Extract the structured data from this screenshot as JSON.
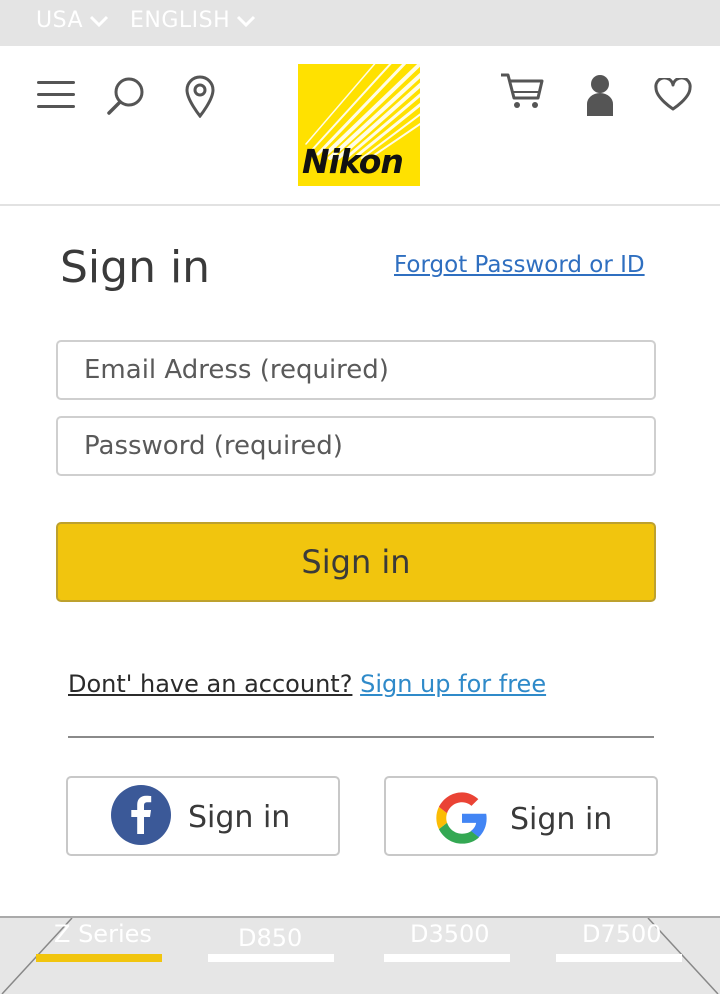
{
  "topbar": {
    "country": "USA",
    "language": "ENGLISH"
  },
  "header": {
    "logo_text": "Nikon",
    "icons": [
      "menu-icon",
      "search-icon",
      "location-pin-icon",
      "cart-icon",
      "user-icon",
      "heart-icon"
    ]
  },
  "signin": {
    "title": "Sign in",
    "forgot_link": "Forgot Password or ID",
    "email_placeholder": "Email Adress (required)",
    "password_placeholder": "Password (required)",
    "submit_label": "Sign in",
    "no_account_text": "Dont' have an account?",
    "signup_link": "Sign up for free",
    "facebook_label": "Sign in",
    "google_label": "Sign in"
  },
  "bottom_nav": {
    "tabs": [
      "Z Series",
      "D850",
      "D3500",
      "D7500"
    ],
    "active_tab": "Z Series"
  },
  "colors": {
    "accent_yellow": "#f1c50e",
    "link_blue": "#2f6fc0",
    "facebook_blue": "#3b5998",
    "logo_yellow": "#ffe100"
  }
}
